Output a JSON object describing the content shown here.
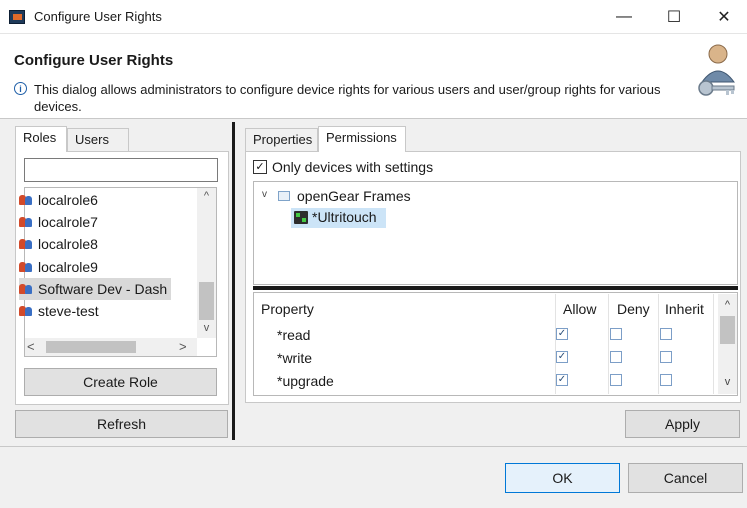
{
  "window": {
    "title": "Configure User Rights",
    "minimize_glyph": "—",
    "maximize_glyph": "☐",
    "close_glyph": "✕"
  },
  "banner": {
    "title": "Configure User Rights",
    "info_glyph": "i",
    "description": "This dialog allows administrators to configure device rights for various users and user/group rights for various devices."
  },
  "left": {
    "tabs": [
      "Roles",
      "Users"
    ],
    "search_value": "",
    "roles": [
      "localrole6",
      "localrole7",
      "localrole8",
      "localrole9",
      "Software Dev - Dash",
      "steve-test"
    ],
    "selected_role_index": 4,
    "create_role_label": "Create Role",
    "refresh_label": "Refresh"
  },
  "right": {
    "tabs": [
      "Properties",
      "Permissions"
    ],
    "active_tab": "Permissions",
    "only_devices_label": "Only devices with settings",
    "only_devices_checked": true,
    "tree": {
      "root_label": "openGear Frames",
      "child_label": "*Ultritouch"
    },
    "table": {
      "headers": [
        "Property",
        "Allow",
        "Deny",
        "Inherit"
      ],
      "rows": [
        {
          "name": "*read",
          "allow": true,
          "deny": false,
          "inherit": false
        },
        {
          "name": "*write",
          "allow": true,
          "deny": false,
          "inherit": false
        },
        {
          "name": "*upgrade",
          "allow": true,
          "deny": false,
          "inherit": false
        }
      ]
    },
    "apply_label": "Apply"
  },
  "footer": {
    "ok_label": "OK",
    "cancel_label": "Cancel"
  },
  "colors": {
    "selection": "#cce4f7",
    "ok_border": "#0078d7"
  }
}
